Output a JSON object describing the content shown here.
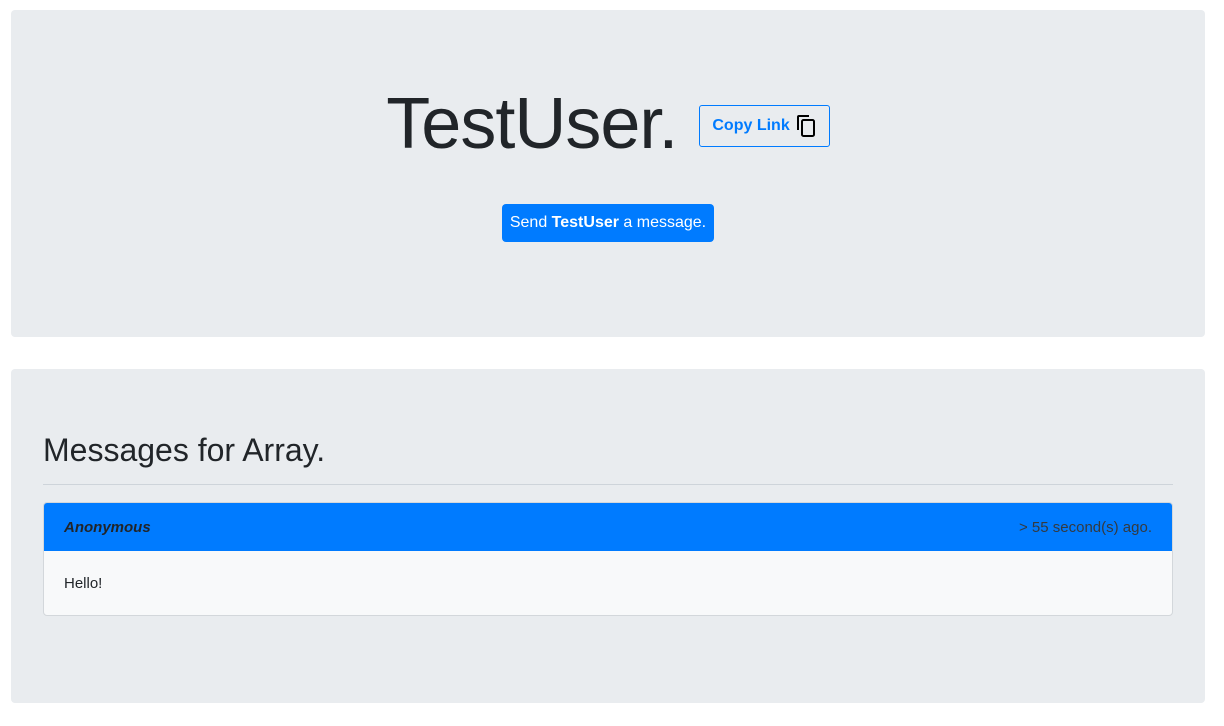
{
  "profile": {
    "title": "TestUser.",
    "copy_link_label": "Copy Link",
    "send_button": {
      "prefix": "Send ",
      "username": "TestUser",
      "suffix": " a message."
    }
  },
  "messages": {
    "heading": "Messages for Array.",
    "items": [
      {
        "sender": "Anonymous",
        "time": "> 55 second(s) ago.",
        "body": "Hello!"
      }
    ]
  },
  "colors": {
    "primary": "#007bff",
    "panel_bg": "#e9ecef",
    "card_body_bg": "#f8f9fa",
    "text": "#212529"
  },
  "icons": {
    "copy": "copy-icon"
  }
}
